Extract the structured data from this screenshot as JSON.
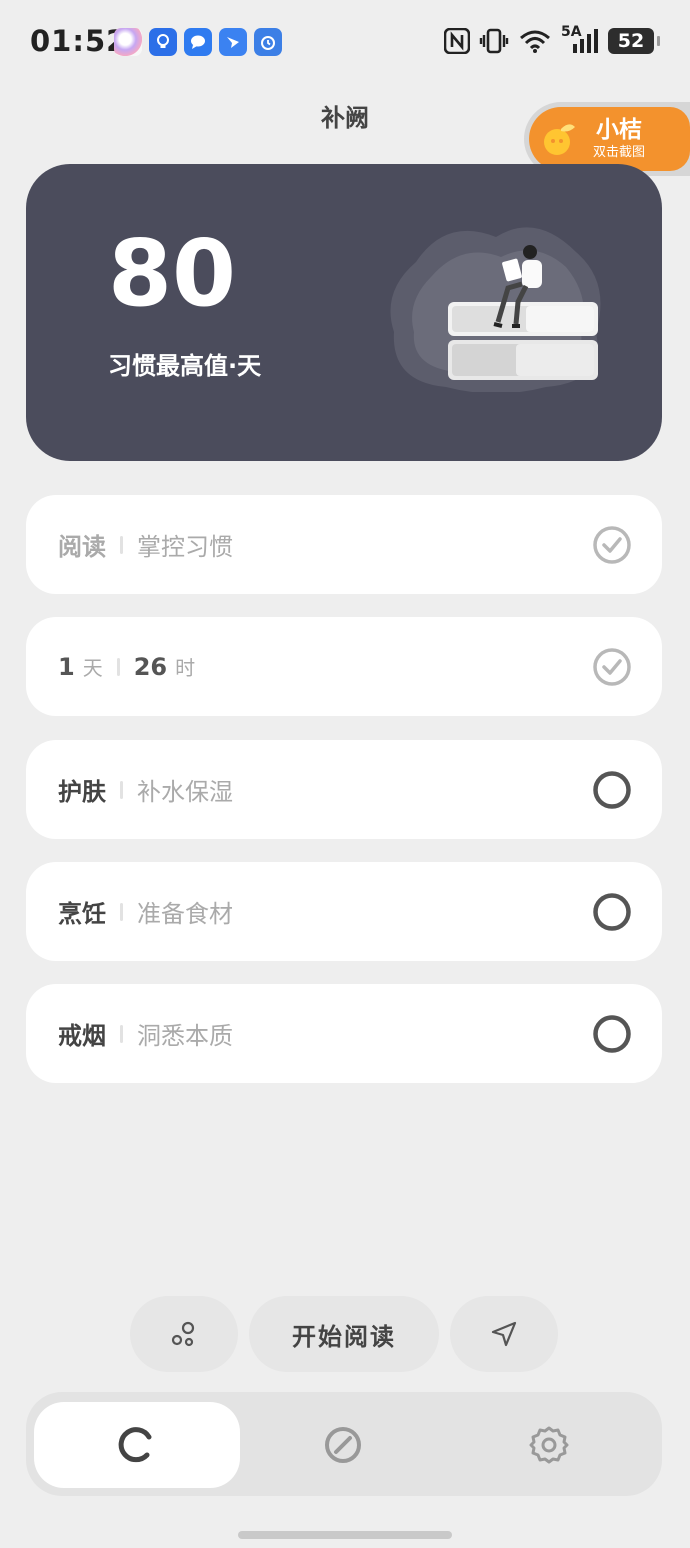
{
  "status_bar": {
    "time": "01:52",
    "battery": "52",
    "app_icons": [
      "assistant-ball-icon",
      "lightbulb-icon",
      "chat-bubble-icon",
      "bird-icon",
      "alarm-icon"
    ],
    "system_icons": [
      "nfc-icon",
      "vibrate-icon",
      "wifi-icon",
      "signal-icon"
    ],
    "network_label": "5A"
  },
  "header": {
    "title": "补阙"
  },
  "assistant": {
    "name": "小桔",
    "subtitle": "双击截图"
  },
  "hero": {
    "value": "80",
    "label": "习惯最高值·天"
  },
  "habits": [
    {
      "name": "阅读",
      "desc": "掌控习惯",
      "done": true
    },
    {
      "days": "1",
      "days_unit": "天",
      "hours": "26",
      "hours_unit": "时",
      "done": true
    },
    {
      "name": "护肤",
      "desc": "补水保湿",
      "done": false
    },
    {
      "name": "烹饪",
      "desc": "准备食材",
      "done": false
    },
    {
      "name": "戒烟",
      "desc": "洞悉本质",
      "done": false
    }
  ],
  "actions": {
    "start_label": "开始阅读"
  },
  "tabs": [
    {
      "icon": "loop-icon",
      "active": true
    },
    {
      "icon": "ban-icon",
      "active": false
    },
    {
      "icon": "settings-gear-icon",
      "active": false
    }
  ],
  "colors": {
    "hero_bg": "#4b4c5c",
    "assistant_orange": "#f3922d",
    "page_bg": "#eeeeee"
  }
}
